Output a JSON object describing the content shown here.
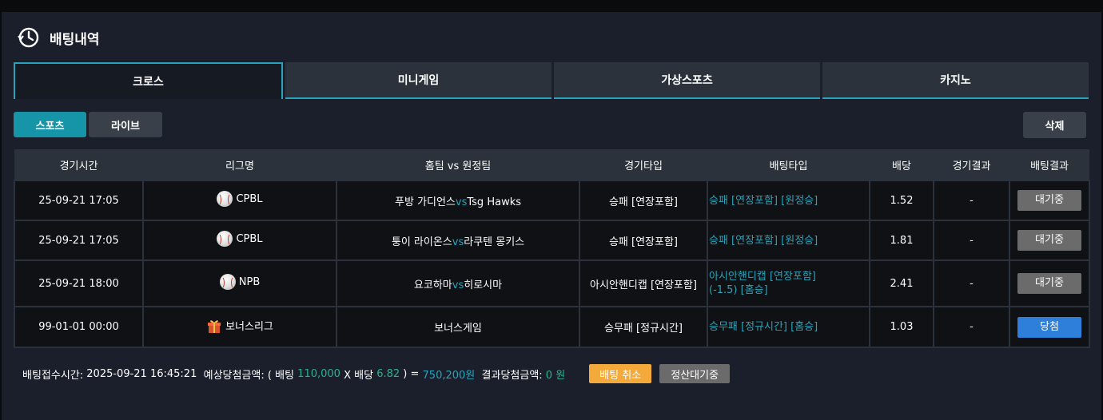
{
  "page_title": "배팅내역",
  "tabs": [
    {
      "label": "크로스",
      "active": true
    },
    {
      "label": "미니게임",
      "active": false
    },
    {
      "label": "가상스포츠",
      "active": false
    },
    {
      "label": "카지노",
      "active": false
    }
  ],
  "sub_buttons": {
    "sports": "스포츠",
    "live": "라이브",
    "delete": "삭제"
  },
  "table": {
    "headers": [
      "경기시간",
      "리그명",
      "홈팀 vs 원정팀",
      "경기타입",
      "배팅타입",
      "배당",
      "경기결과",
      "배팅결과"
    ],
    "rows": [
      {
        "time": "25-09-21 17:05",
        "league": "CPBL",
        "league_icon": "baseball-icon",
        "home": "푸방 가디언스",
        "vs": "vs",
        "away": "Tsg Hawks",
        "game_type": "승패 [연장포함]",
        "bet_type": "승패 [연장포함] [원정승]",
        "odds": "1.52",
        "game_result": "-",
        "bet_result": "대기중",
        "bet_result_style": "wait"
      },
      {
        "time": "25-09-21 17:05",
        "league": "CPBL",
        "league_icon": "baseball-icon",
        "home": "퉁이 라이온스",
        "vs": "vs",
        "away": "라쿠텐 몽키스",
        "game_type": "승패 [연장포함]",
        "bet_type": "승패 [연장포함] [원정승]",
        "odds": "1.81",
        "game_result": "-",
        "bet_result": "대기중",
        "bet_result_style": "wait"
      },
      {
        "time": "25-09-21 18:00",
        "league": "NPB",
        "league_icon": "baseball-icon",
        "home": "요코하마",
        "vs": "vs",
        "away": "히로시마",
        "game_type": "아시안핸디캡 [연장포함]",
        "bet_type_line1": "아시안핸디캡 [연장포함]",
        "bet_type_line2": "(-1.5) [홈승]",
        "odds": "2.41",
        "game_result": "-",
        "bet_result": "대기중",
        "bet_result_style": "wait"
      },
      {
        "time": "99-01-01 00:00",
        "league": "보너스리그",
        "league_icon": "gift-box-icon",
        "match": "보너스게임",
        "game_type": "승무패 [정규시간]",
        "bet_type": "승무패 [정규시간] [홈승]",
        "odds": "1.03",
        "game_result": "-",
        "bet_result": "당첨",
        "bet_result_style": "win"
      }
    ]
  },
  "footer": {
    "received_label": "배팅접수시간:",
    "received_time": "2025-09-21 16:45:21",
    "expected_label": "예상당첨금액: ( 배팅",
    "bet_amount": "110,000",
    "x_odds_label": "X 배당",
    "total_odds": "6.82",
    "close_eq": ") =",
    "expected_amount": "750,200원",
    "result_label": "결과당첨금액:",
    "result_amount": "0 원",
    "cancel_button": "배팅 취소",
    "status_button": "정산대기중"
  },
  "colors": {
    "accent": "#2aa3ba",
    "sports_button": "#1694a8",
    "win": "#2e7fd9",
    "wait": "#6b6b6b",
    "cancel": "#f4a93b",
    "green_text": "#27b38d"
  }
}
